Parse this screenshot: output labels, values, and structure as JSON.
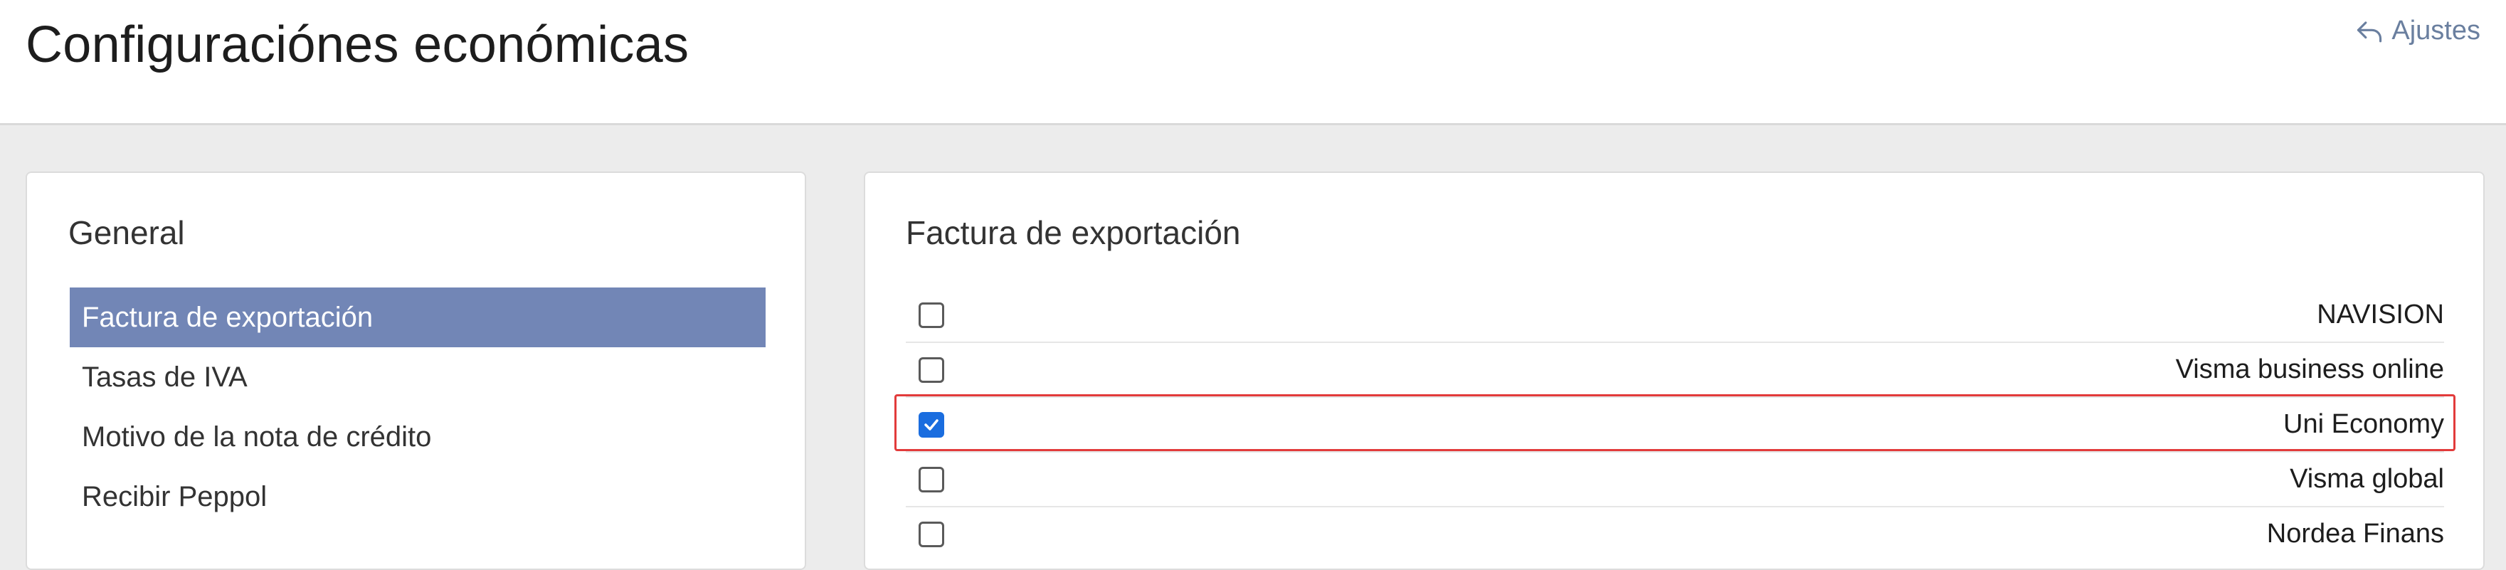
{
  "header": {
    "title": "Configuraciónes económicas",
    "back_label": "Ajustes",
    "back_icon": "reply-arrow-icon"
  },
  "left_panel": {
    "heading": "General",
    "items": [
      {
        "label": "Factura de exportación",
        "active": true
      },
      {
        "label": "Tasas de IVA",
        "active": false
      },
      {
        "label": "Motivo de la nota de crédito",
        "active": false
      },
      {
        "label": "Recibir Peppol",
        "active": false
      }
    ]
  },
  "right_panel": {
    "heading": "Factura de exportación",
    "options": [
      {
        "label": "NAVISION",
        "checked": false
      },
      {
        "label": "Visma business online",
        "checked": false
      },
      {
        "label": "Uni Economy",
        "checked": true
      },
      {
        "label": "Visma global",
        "checked": false
      },
      {
        "label": "Nordea Finans",
        "checked": false
      }
    ]
  },
  "colors": {
    "active_item_bg": "#7286b6",
    "checkbox_checked": "#1a6ddf",
    "highlight_border": "#e23b3b",
    "link": "#6a7f9f"
  }
}
